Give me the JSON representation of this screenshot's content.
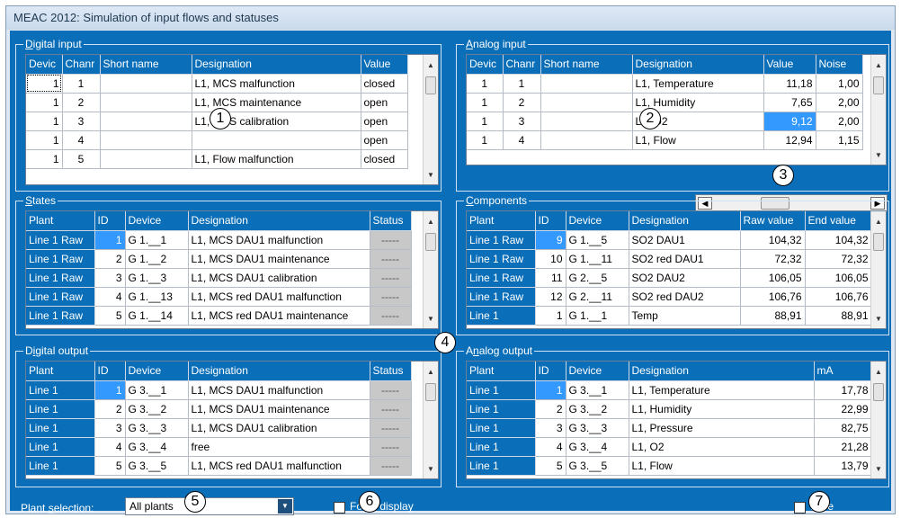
{
  "window": {
    "title": "MEAC 2012: Simulation of input flows and statuses"
  },
  "digital_input": {
    "title_u": "D",
    "title_rest": "igital input",
    "columns": [
      "Devic",
      "Chanr",
      "Short name",
      "Designation",
      "Value"
    ],
    "rows": [
      {
        "device": "1",
        "channel": "1",
        "short": "",
        "designation": "L1, MCS malfunction",
        "value": "closed"
      },
      {
        "device": "1",
        "channel": "2",
        "short": "",
        "designation": "L1, MCS maintenance",
        "value": "open"
      },
      {
        "device": "1",
        "channel": "3",
        "short": "",
        "designation": "L1, MCS calibration",
        "value": "open"
      },
      {
        "device": "1",
        "channel": "4",
        "short": "",
        "designation": "",
        "value": "open"
      },
      {
        "device": "1",
        "channel": "5",
        "short": "",
        "designation": "L1, Flow malfunction",
        "value": "closed"
      }
    ]
  },
  "analog_input": {
    "title_u": "A",
    "title_rest": "nalog input",
    "columns": [
      "Devic",
      "Chanr",
      "Short name",
      "Designation",
      "Value",
      "Noise"
    ],
    "rows": [
      {
        "device": "1",
        "channel": "1",
        "short": "",
        "designation": "L1, Temperature",
        "value": "11,18",
        "noise": "1,00"
      },
      {
        "device": "1",
        "channel": "2",
        "short": "",
        "designation": "L1, Humidity",
        "value": "7,65",
        "noise": "2,00"
      },
      {
        "device": "1",
        "channel": "3",
        "short": "",
        "designation": "L1, O2",
        "value": "9,12",
        "noise": "2,00"
      },
      {
        "device": "1",
        "channel": "4",
        "short": "",
        "designation": "L1, Flow",
        "value": "12,94",
        "noise": "1,15"
      }
    ]
  },
  "states": {
    "title_u": "S",
    "title_rest": "tates",
    "columns": [
      "Plant",
      "ID",
      "Device",
      "Designation",
      "Status"
    ],
    "rows": [
      {
        "plant": "Line 1 Raw",
        "id": "1",
        "device": "G 1.__1",
        "designation": "L1, MCS DAU1 malfunction",
        "status": "-----"
      },
      {
        "plant": "Line 1 Raw",
        "id": "2",
        "device": "G 1.__2",
        "designation": "L1, MCS DAU1 maintenance",
        "status": "-----"
      },
      {
        "plant": "Line 1 Raw",
        "id": "3",
        "device": "G 1.__3",
        "designation": "L1, MCS DAU1 calibration",
        "status": "-----"
      },
      {
        "plant": "Line 1 Raw",
        "id": "4",
        "device": "G 1.__13",
        "designation": "L1, MCS red DAU1 malfunction",
        "status": "-----"
      },
      {
        "plant": "Line 1 Raw",
        "id": "5",
        "device": "G 1.__14",
        "designation": "L1, MCS red DAU1 maintenance",
        "status": "-----"
      }
    ]
  },
  "components": {
    "title_u": "C",
    "title_rest": "omponents",
    "columns": [
      "Plant",
      "ID",
      "Device",
      "Designation",
      "Raw value",
      "End value"
    ],
    "rows": [
      {
        "plant": "Line 1 Raw",
        "id": "9",
        "device": "G 1.__5",
        "designation": "SO2 DAU1",
        "raw": "104,32",
        "end": "104,32"
      },
      {
        "plant": "Line 1 Raw",
        "id": "10",
        "device": "G 1.__11",
        "designation": "SO2 red DAU1",
        "raw": "72,32",
        "end": "72,32"
      },
      {
        "plant": "Line 1 Raw",
        "id": "11",
        "device": "G 2.__5",
        "designation": "SO2 DAU2",
        "raw": "106,05",
        "end": "106,05"
      },
      {
        "plant": "Line 1 Raw",
        "id": "12",
        "device": "G 2.__11",
        "designation": "SO2 red DAU2",
        "raw": "106,76",
        "end": "106,76"
      },
      {
        "plant": "Line 1",
        "id": "1",
        "device": "G 1.__1",
        "designation": "Temp",
        "raw": "88,91",
        "end": "88,91"
      }
    ]
  },
  "digital_output": {
    "title_u": "i",
    "title_pre": "D",
    "title_rest": "gital output",
    "columns": [
      "Plant",
      "ID",
      "Device",
      "Designation",
      "Status"
    ],
    "rows": [
      {
        "plant": "Line 1",
        "id": "1",
        "device": "G 3.__1",
        "designation": "L1, MCS DAU1 malfunction",
        "status": "-----"
      },
      {
        "plant": "Line 1",
        "id": "2",
        "device": "G 3.__2",
        "designation": "L1, MCS DAU1 maintenance",
        "status": "-----"
      },
      {
        "plant": "Line 1",
        "id": "3",
        "device": "G 3.__3",
        "designation": "L1, MCS DAU1 calibration",
        "status": "-----"
      },
      {
        "plant": "Line 1",
        "id": "4",
        "device": "G 3.__4",
        "designation": "free",
        "status": "-----"
      },
      {
        "plant": "Line 1",
        "id": "5",
        "device": "G 3.__5",
        "designation": "L1, MCS red DAU1 malfunction",
        "status": "-----"
      }
    ]
  },
  "analog_output": {
    "title_u": "n",
    "title_pre": "A",
    "title_rest": "alog output",
    "columns": [
      "Plant",
      "ID",
      "Device",
      "Designation",
      "mA"
    ],
    "rows": [
      {
        "plant": "Line 1",
        "id": "1",
        "device": "G 3.__1",
        "designation": "L1, Temperature",
        "ma": "17,78"
      },
      {
        "plant": "Line 1",
        "id": "2",
        "device": "G 3.__2",
        "designation": "L1, Humidity",
        "ma": "22,99"
      },
      {
        "plant": "Line 1",
        "id": "3",
        "device": "G 3.__3",
        "designation": "L1, Pressure",
        "ma": "82,75"
      },
      {
        "plant": "Line 1",
        "id": "4",
        "device": "G 3.__4",
        "designation": "L1, O2",
        "ma": "21,28"
      },
      {
        "plant": "Line 1",
        "id": "5",
        "device": "G 3.__5",
        "designation": "L1, Flow",
        "ma": "13,79"
      }
    ]
  },
  "bottom": {
    "plant_selection_pre": "Plant ",
    "plant_selection_u": "s",
    "plant_selection_post": "election:",
    "plant_selection_value": "All plants",
    "checkbox1_label": "Fo   es display",
    "checkbox2_label": "In   se"
  },
  "callouts": [
    "1",
    "2",
    "3",
    "4",
    "5",
    "6",
    "7"
  ],
  "colors": {
    "panel": "#0a6fb8",
    "selection": "#3399ff",
    "status_cell": "#c8c8c8"
  }
}
